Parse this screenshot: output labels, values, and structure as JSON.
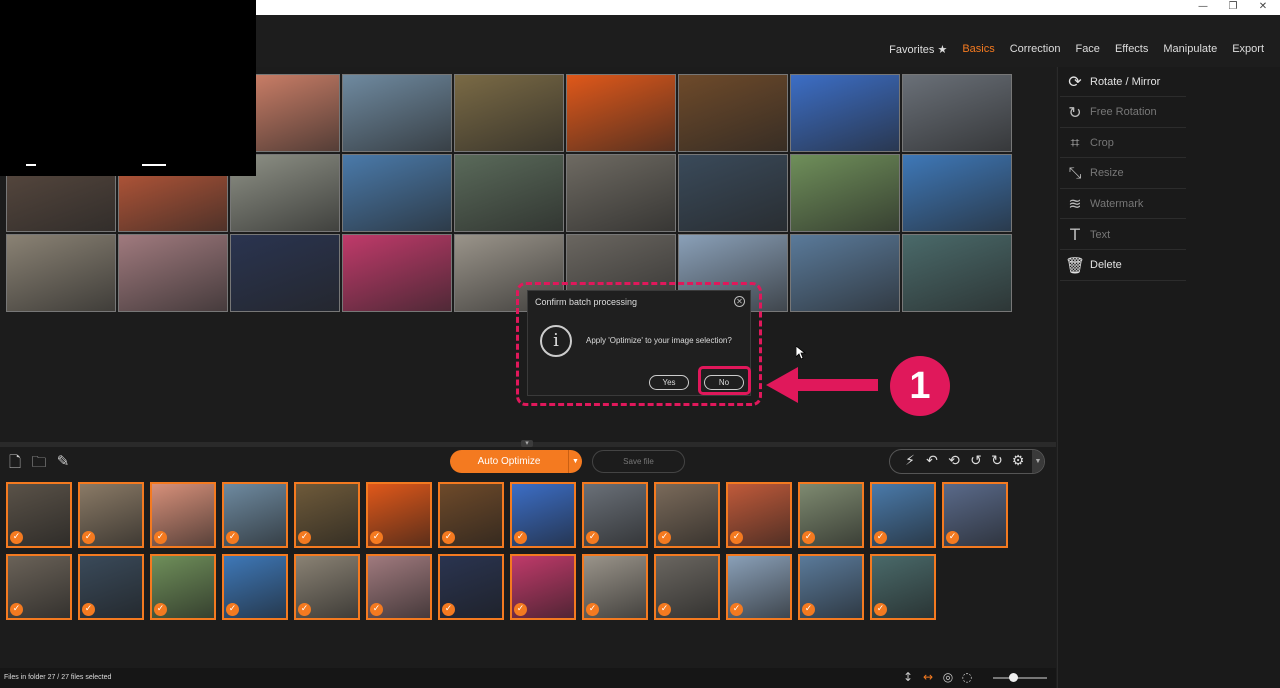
{
  "nav": [
    "Favorites ★",
    "Basics",
    "Correction",
    "Face",
    "Effects",
    "Manipulate",
    "Export"
  ],
  "nav_active": "Basics",
  "window_controls": [
    "—",
    "❐",
    "✕"
  ],
  "tools": [
    {
      "label": "Rotate / Mirror",
      "icon": "rotate-icon",
      "enabled": true
    },
    {
      "label": "Free Rotation",
      "icon": "free-rotation-icon",
      "enabled": false
    },
    {
      "label": "Crop",
      "icon": "crop-icon",
      "enabled": false
    },
    {
      "label": "Resize",
      "icon": "resize-icon",
      "enabled": false
    },
    {
      "label": "Watermark",
      "icon": "watermark-icon",
      "enabled": false
    },
    {
      "label": "Text",
      "icon": "text-icon",
      "enabled": false
    },
    {
      "label": "Delete",
      "icon": "trash-icon",
      "enabled": true
    }
  ],
  "dialog": {
    "title": "Confirm batch processing",
    "message": "Apply 'Optimize' to your image selection?",
    "yes_label": "Yes",
    "no_label": "No",
    "icon": "info-icon"
  },
  "annotation": {
    "step_number": "1",
    "color": "#e0185b"
  },
  "toolbar": {
    "auto_optimize_label": "Auto Optimize",
    "save_file_label": "Save file",
    "left_icons": [
      "add-files-icon",
      "add-folder-icon",
      "brush-icon"
    ],
    "right_icons": [
      "magic-wand-icon",
      "undo-icon",
      "undo-all-icon",
      "rotate-left-icon",
      "rotate-right-icon",
      "settings-icon"
    ]
  },
  "status": {
    "text": "Files in folder 27 / 27 files selected"
  },
  "status_icons": [
    "vertical-arrows-icon",
    "horizontal-arrows-icon",
    "compare-icon",
    "loading-icon"
  ],
  "accent": "#f47a20",
  "grid_tile_colors": [
    [
      "#3a3a3a",
      "#3a3a3a",
      "#d2826a",
      "#6f8aa0",
      "#7a6a45",
      "#e0581a",
      "#6e4a2a",
      "#3c6ec6",
      "#6a7078"
    ],
    [
      "#5a4a40",
      "#c05a3a",
      "#8e9186",
      "#4a7aaa",
      "#5a6a5a",
      "#6e6a62",
      "#3a4a5a",
      "#6f8f5a",
      "#3e78b8"
    ],
    [
      "#8a8274",
      "#a07a7e",
      "#2a3450",
      "#c03a6a",
      "#9a948a",
      "#6a6660",
      "#8aa0b8",
      "#5a7a9a",
      "#4a6a6a"
    ]
  ],
  "thumb_colors": [
    [
      "#5a5248",
      "#8a7a66",
      "#d7907a",
      "#6e8aa0",
      "#6e5a3a",
      "#e0581a",
      "#6e4a2a",
      "#3c6ec6",
      "#6a7078",
      "#7a6a5a",
      "#c05a3a",
      "#7e8a70",
      "#4a7aaa",
      "#5a6a8a"
    ],
    [
      "#6a6258",
      "#3a4a5a",
      "#6f8f5a",
      "#3e78b8",
      "#8a8274",
      "#a07a7e",
      "#2a3450",
      "#c03a6a",
      "#9a948a",
      "#6a6660",
      "#8aa0b8",
      "#5a7a9a",
      "#4a6a6a"
    ]
  ]
}
